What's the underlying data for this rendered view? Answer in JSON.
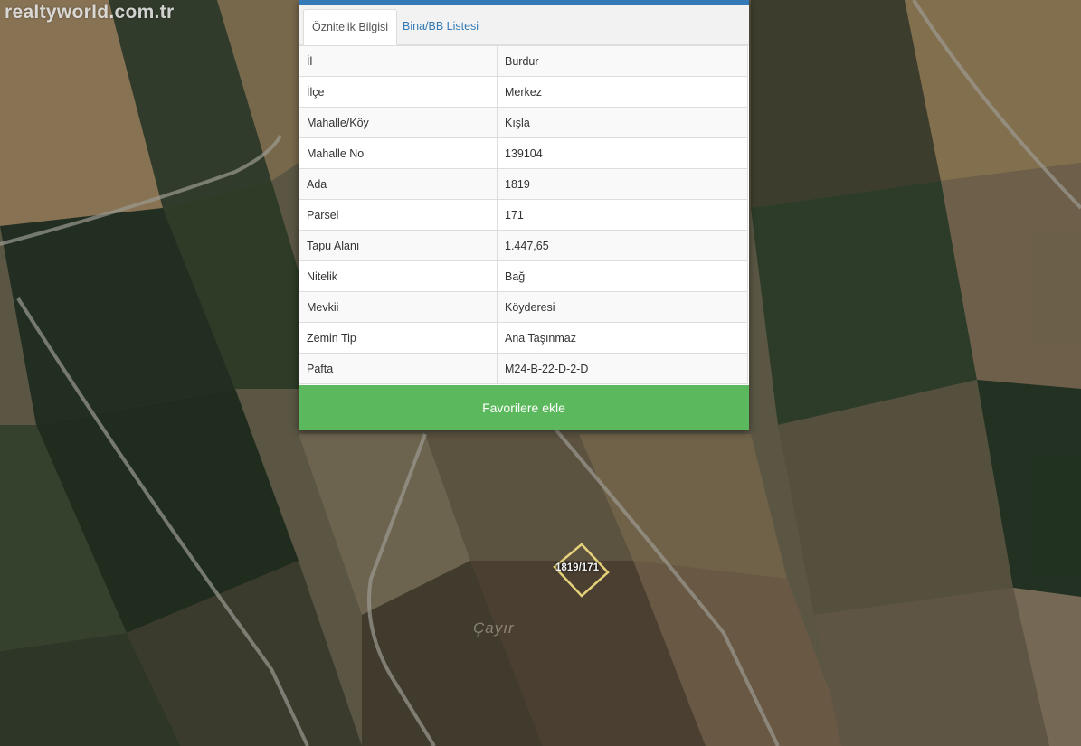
{
  "watermark": "realtyworld.com.tr",
  "tabs": [
    {
      "label": "Öznitelik Bilgisi",
      "active": true
    },
    {
      "label": "Bina/BB Listesi",
      "active": false
    }
  ],
  "attributes": [
    {
      "key": "İl",
      "value": "Burdur"
    },
    {
      "key": "İlçe",
      "value": "Merkez"
    },
    {
      "key": "Mahalle/Köy",
      "value": "Kışla"
    },
    {
      "key": "Mahalle No",
      "value": "139104"
    },
    {
      "key": "Ada",
      "value": "1819"
    },
    {
      "key": "Parsel",
      "value": "171"
    },
    {
      "key": "Tapu Alanı",
      "value": "1.447,65"
    },
    {
      "key": "Nitelik",
      "value": "Bağ"
    },
    {
      "key": "Mevkii",
      "value": "Köyderesi"
    },
    {
      "key": "Zemin Tip",
      "value": "Ana Taşınmaz"
    },
    {
      "key": "Pafta",
      "value": "M24-B-22-D-2-D"
    }
  ],
  "favorite_button": "Favorilere ekle",
  "map": {
    "parcel_label": "1819/171",
    "place_label": "Çayır"
  },
  "colors": {
    "accent": "#337ab7",
    "button": "#5cb85c",
    "parcel_outline": "#e6d27a"
  }
}
